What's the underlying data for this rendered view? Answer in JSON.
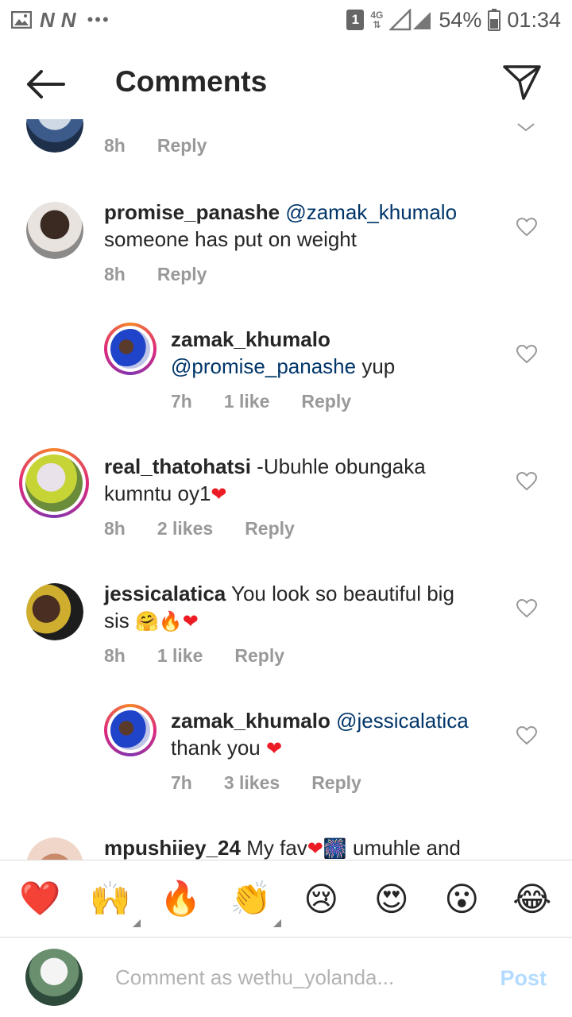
{
  "status_bar": {
    "sim_slot": "1",
    "network": "4G",
    "battery": "54%",
    "time": "01:34",
    "left_icons": [
      "gallery-icon",
      "n-notification-icon",
      "n-notification-icon",
      "more-dots-icon"
    ]
  },
  "header": {
    "title": "Comments",
    "back_icon": "arrow-left-icon",
    "share_icon": "paper-plane-icon"
  },
  "comments": [
    {
      "time": "8h",
      "reply_label": "Reply"
    },
    {
      "username": "promise_panashe",
      "mention": "@zamak_khumalo",
      "text": "someone has put on weight",
      "time": "8h",
      "reply_label": "Reply"
    },
    {
      "username": "zamak_khumalo",
      "mention": "@promise_panashe",
      "text": " yup",
      "time": "7h",
      "likes": "1 like",
      "reply_label": "Reply"
    },
    {
      "username": "real_thatohatsi",
      "text": " -Ubuhle obungaka",
      "text2": "kumntu oy1",
      "time": "8h",
      "likes": "2 likes",
      "reply_label": "Reply"
    },
    {
      "username": "jessicalatica",
      "text": " You look so beautiful big",
      "text2": "sis ",
      "time": "8h",
      "likes": "1 like",
      "reply_label": "Reply"
    },
    {
      "username": "zamak_khumalo",
      "mention": "@jessicalatica",
      "text": "thank you ",
      "time": "7h",
      "likes": "3 likes",
      "reply_label": "Reply"
    },
    {
      "username": "mpushiiey_24",
      "text": " My fav",
      "text2": " umuhle and"
    }
  ],
  "emoji_bar": [
    "❤️",
    "🙌",
    "🔥",
    "👏",
    "😢",
    "😍",
    "😮",
    "😂"
  ],
  "composer": {
    "placeholder": "Comment as wethu_yolanda...",
    "post_label": "Post"
  },
  "colors": {
    "accent_link": "#003569",
    "muted": "#999999",
    "post_disabled": "#b3dbff",
    "heart_red": "#ed1c24"
  }
}
